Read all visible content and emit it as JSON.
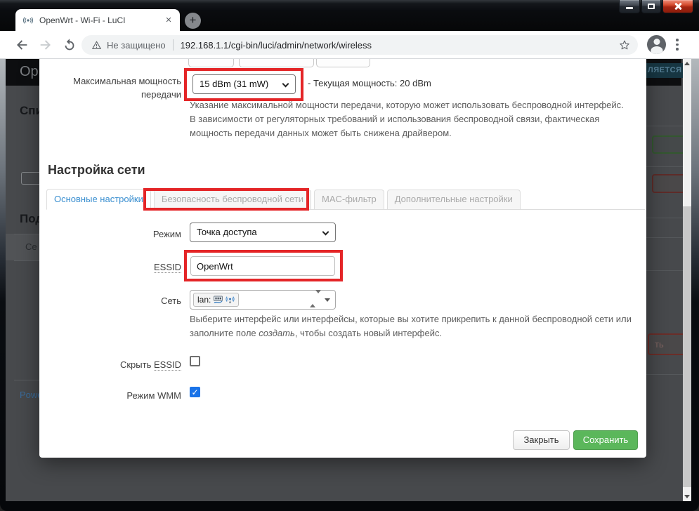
{
  "browser": {
    "tab_title": "OpenWrt - Wi-Fi - LuCI",
    "tab_close_glyph": "×",
    "new_tab_glyph": "+",
    "security_label": "Не защищено",
    "url": "192.168.1.1/cgi-bin/luci/admin/network/wireless"
  },
  "background_page": {
    "header_text_fragment": "Op",
    "status_badge_fragment": "ЛЯЕТСЯ",
    "section_heading_fragment_1": "Спи",
    "section_heading_fragment_2": "Под",
    "table_cell_fragment": "Се",
    "footer_link_fragment": "Powe",
    "button_fragment": "ть"
  },
  "modal": {
    "power": {
      "label": "Максимальная мощность передачи",
      "value": "15 dBm (31 mW)",
      "current_power": "- Текущая мощность: 20 dBm",
      "description": "Указание максимальной мощности передачи, которую может использовать беспроводной интерфейс. В зависимости от регуляторных требований и использования беспроводной связи, фактическая мощность передачи данных может быть снижена драйвером."
    },
    "section_title": "Настройка сети",
    "tabs": [
      {
        "label": "Основные настройки",
        "active": true
      },
      {
        "label": "Безопасность беспроводной сети",
        "active": false,
        "annotated": true
      },
      {
        "label": "MAC-фильтр",
        "active": false
      },
      {
        "label": "Дополнительные настройки",
        "active": false
      }
    ],
    "mode": {
      "label": "Режим",
      "value": "Точка доступа"
    },
    "essid": {
      "label": "ESSID",
      "value": "OpenWrt"
    },
    "network": {
      "label": "Сеть",
      "selected_tag": "lan:",
      "description_before": "Выберите интерфейс или интерфейсы, которые вы хотите прикрепить к данной беспроводной сети или заполните поле ",
      "description_italic": "создать",
      "description_after": ", чтобы создать новый интерфейс."
    },
    "hide_essid": {
      "label_prefix": "Скрыть ",
      "label_term": "ESSID",
      "checked": false
    },
    "wmm": {
      "label": "Режим WMM",
      "checked": true,
      "checkmark": "✓"
    },
    "buttons": {
      "close": "Закрыть",
      "save": "Сохранить"
    }
  },
  "colors": {
    "annotation_red": "#e42527",
    "luci_link_blue": "#3a8fd0",
    "save_green": "#5bb75b",
    "checkbox_blue": "#1a73e8",
    "close_button_red": "#a52613"
  }
}
